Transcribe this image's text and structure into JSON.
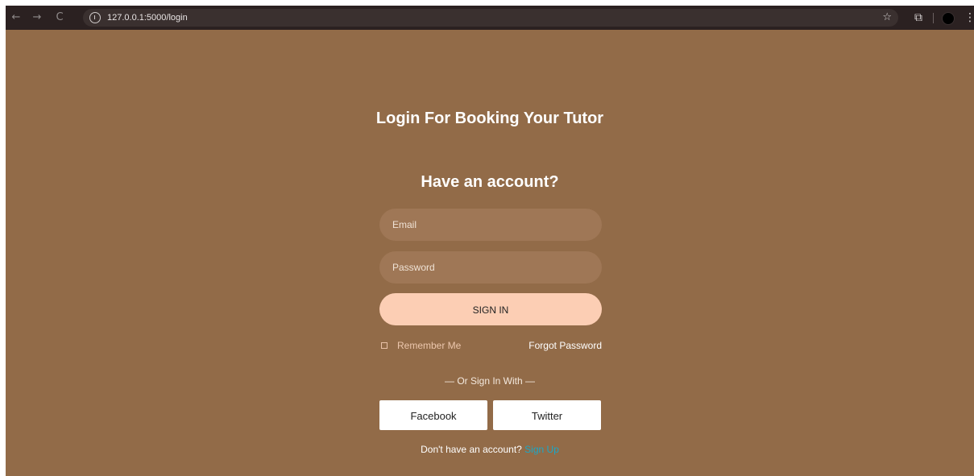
{
  "browser": {
    "url": "127.0.0.1:5000/login",
    "back_icon": "←",
    "forward_icon": "→",
    "reload_icon": "C",
    "star_icon": "☆",
    "extensions_icon": "⧉",
    "menu_icon": "⋮"
  },
  "page": {
    "title": "Login For Booking Your Tutor",
    "subtitle": "Have an account?",
    "email_placeholder": "Email",
    "password_placeholder": "Password",
    "signin_label": "SIGN IN",
    "remember_label": "Remember Me",
    "forgot_label": "Forgot Password",
    "or_text": "— Or Sign In With —",
    "facebook_label": "Facebook",
    "twitter_label": "Twitter",
    "no_account_text": "Don't have an account?",
    "signup_label": "Sign Up"
  },
  "colors": {
    "background": "#926B48",
    "field_bg": "#9F7756",
    "button_bg": "#FCCEB4",
    "link": "#1aa8c7"
  }
}
